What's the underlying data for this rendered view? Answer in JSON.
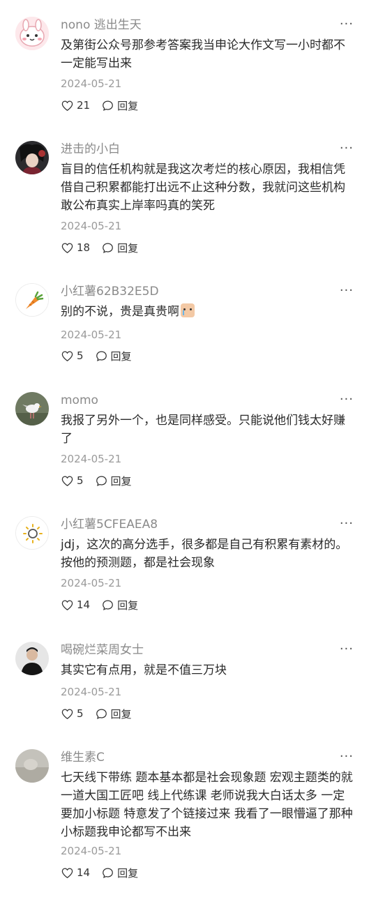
{
  "comments": [
    {
      "user": "nono 逃出生天",
      "text": "及第街公众号那参考答案我当申论大作文写一小时都不一定能写出来",
      "date": "2024-05-21",
      "likes": "21",
      "reply": "回复",
      "more": "···",
      "avatar": "pink-bunny-avatar"
    },
    {
      "user": "进击的小白",
      "text": "盲目的信任机构就是我这次考烂的核心原因，我相信凭借自己积累都能打出远不止这种分数，我就问这些机构敢公布真实上岸率吗真的笑死",
      "date": "2024-05-21",
      "likes": "18",
      "reply": "回复",
      "more": "···",
      "avatar": "anime-avatar"
    },
    {
      "user": "小红薯62B32E5D",
      "text": "别的不说，贵是真贵啊",
      "date": "2024-05-21",
      "likes": "5",
      "reply": "回复",
      "more": "···",
      "avatar": "carrot-avatar"
    },
    {
      "user": "momo",
      "text": "我报了另外一个，也是同样感受。只能说他们钱太好赚了",
      "date": "2024-05-21",
      "likes": "5",
      "reply": "回复",
      "more": "···",
      "avatar": "seagull-avatar"
    },
    {
      "user": "小红薯5CFEAEA8",
      "text": "jdj，这次的高分选手，很多都是自己有积累有素材的。按他的预测题，都是社会现象",
      "date": "2024-05-21",
      "likes": "14",
      "reply": "回复",
      "more": "···",
      "avatar": "sun-avatar"
    },
    {
      "user": "喝碗烂菜周女士",
      "text": "其实它有点用，就是不值三万块",
      "date": "2024-05-21",
      "likes": "5",
      "reply": "回复",
      "more": "···",
      "avatar": "person-avatar"
    },
    {
      "user": "维生素C",
      "text": "七天线下带练 题本基本都是社会现象题 宏观主题类的就一道大国工匠吧 线上代练课 老师说我大白话太多 一定要加小标题 特意发了个链接过来 我看了一眼懵逼了那种小标题我申论都写不出来",
      "date": "2024-05-21",
      "likes": "14",
      "reply": "回复",
      "more": "···",
      "avatar": "gray-avatar"
    }
  ]
}
